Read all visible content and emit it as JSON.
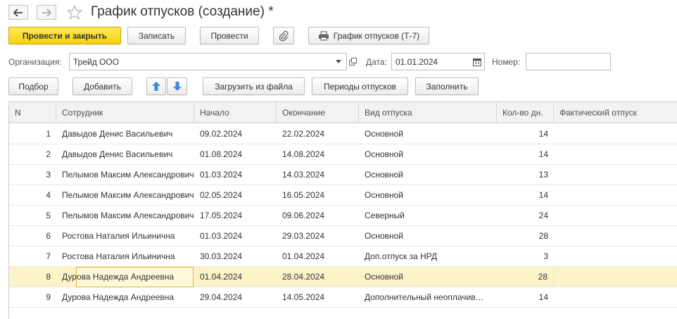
{
  "window": {
    "title": "График отпусков (создание) *"
  },
  "nav": {
    "back_icon": "arrow-left-icon",
    "forward_icon": "arrow-right-icon",
    "favorite_icon": "star-icon"
  },
  "toolbar": {
    "post_and_close": "Провести и закрыть",
    "save": "Записать",
    "post": "Провести",
    "attach_icon": "paperclip-icon",
    "print_form": "График отпусков (Т-7)",
    "print_icon": "printer-icon"
  },
  "form": {
    "org_label": "Организация:",
    "org_value": "Трейд ООО",
    "date_label": "Дата:",
    "date_value": "01.01.2024",
    "number_label": "Номер:",
    "number_value": ""
  },
  "table_toolbar": {
    "pick": "Подбор",
    "add": "Добавить",
    "load_file": "Загрузить из файла",
    "periods": "Периоды отпусков",
    "fill": "Заполнить"
  },
  "table": {
    "columns": [
      "N",
      "Сотрудник",
      "Начало",
      "Окончание",
      "Вид отпуска",
      "Кол-во дн.",
      "Фактический отпуск"
    ],
    "rows": [
      [
        "1",
        "Давыдов Денис Васильевич",
        "09.02.2024",
        "22.02.2024",
        "Основной",
        "14",
        ""
      ],
      [
        "2",
        "Давыдов Денис Васильевич",
        "01.08.2024",
        "14.08.2024",
        "Основной",
        "14",
        ""
      ],
      [
        "3",
        "Пелымов Максим Александрович",
        "01.03.2024",
        "14.03.2024",
        "Основной",
        "13",
        ""
      ],
      [
        "4",
        "Пелымов Максим Александрович",
        "02.05.2024",
        "16.05.2024",
        "Основной",
        "14",
        ""
      ],
      [
        "5",
        "Пелымов Максим Александрович",
        "17.05.2024",
        "09.06.2024",
        "Северный",
        "24",
        ""
      ],
      [
        "6",
        "Ростова Наталия Ильинична",
        "01.03.2024",
        "29.03.2024",
        "Основной",
        "28",
        ""
      ],
      [
        "7",
        "Ростова Наталия Ильинична",
        "30.03.2024",
        "01.04.2024",
        "Доп.отпуск за НРД",
        "3",
        ""
      ],
      [
        "8",
        "Дурова Надежда Андреевна",
        "01.04.2024",
        "28.04.2024",
        "Основной",
        "28",
        ""
      ],
      [
        "9",
        "Дурова Надежда Андреевна",
        "29.04.2024",
        "14.05.2024",
        "Дополнительный неоплачиваемый",
        "14",
        ""
      ]
    ],
    "selected_row": 8
  },
  "colors": {
    "primary": "#f5d30a",
    "selected_row": "#fdf3c9",
    "arrow_blue": "#3a8ad8"
  }
}
